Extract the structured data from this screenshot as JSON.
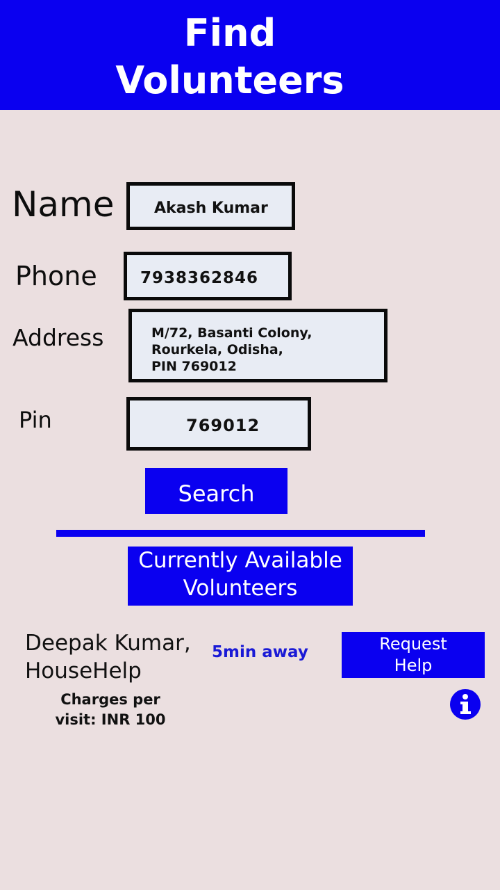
{
  "header": {
    "title": "Find\nVolunteers"
  },
  "form": {
    "name_label": "Name",
    "name_value": "Akash Kumar",
    "phone_label": "Phone",
    "phone_value": "7938362846",
    "address_label": "Address",
    "address_value": "M/72, Basanti Colony,\nRourkela, Odisha,\nPIN 769012",
    "pin_label": "Pin",
    "pin_value": "769012",
    "search_button": "Search"
  },
  "volunteers": {
    "heading": "Currently Available\nVolunteers",
    "items": [
      {
        "name": "Deepak Kumar,\nHouseHelp",
        "distance": "5min away",
        "charges": "Charges per\nvisit: INR 100",
        "request_button": "Request\nHelp",
        "info_icon": "info-icon"
      }
    ]
  },
  "colors": {
    "accent": "#0a00f0",
    "background": "#ebdfe0",
    "field_background": "#e8ecf4",
    "distance_text": "#1a1ad6"
  }
}
